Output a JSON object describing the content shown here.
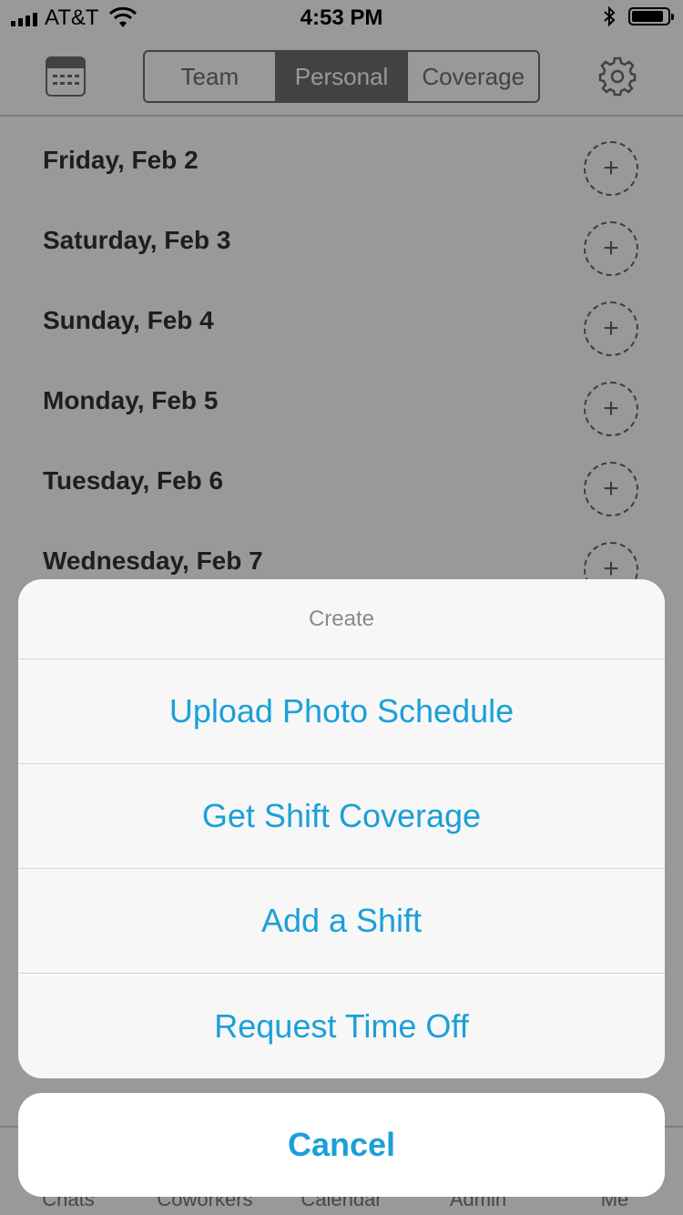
{
  "status_bar": {
    "carrier": "AT&T",
    "time": "4:53 PM"
  },
  "nav": {
    "segments": [
      "Team",
      "Personal",
      "Coverage"
    ],
    "active_segment": "Personal",
    "calendar_icon": "calendar-icon",
    "settings_icon": "gear-icon"
  },
  "days": [
    {
      "label": "Friday, Feb 2"
    },
    {
      "label": "Saturday, Feb 3"
    },
    {
      "label": "Sunday, Feb 4"
    },
    {
      "label": "Monday, Feb 5"
    },
    {
      "label": "Tuesday, Feb 6"
    },
    {
      "label": "Wednesday, Feb 7"
    }
  ],
  "tabbar": {
    "tabs": [
      "Chats",
      "Coworkers",
      "Calendar",
      "Admin",
      "Me"
    ]
  },
  "action_sheet": {
    "title": "Create",
    "actions": [
      "Upload Photo Schedule",
      "Get Shift Coverage",
      "Add a Shift",
      "Request Time Off"
    ],
    "cancel": "Cancel"
  },
  "colors": {
    "accent": "#1aa0d8",
    "segment": "#6f6f6f",
    "overlay": "rgba(0,0,0,0.40)"
  }
}
